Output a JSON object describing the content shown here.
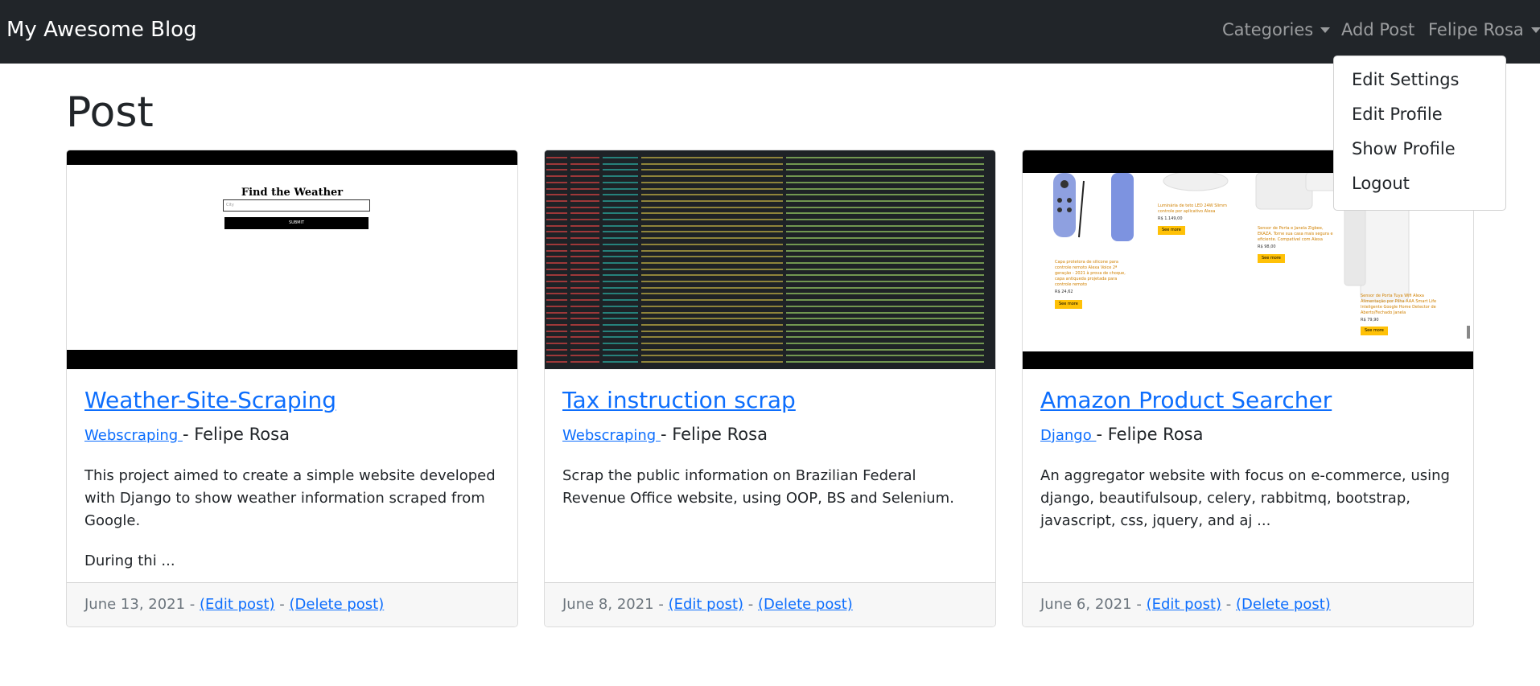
{
  "navbar": {
    "brand": "My Awesome Blog",
    "categories": "Categories",
    "add_post": "Add Post",
    "user": "Felipe Rosa",
    "background": "#212529"
  },
  "dropdown": {
    "items": [
      "Edit Settings",
      "Edit Profile",
      "Show Profile",
      "Logout"
    ]
  },
  "page": {
    "title": "Post"
  },
  "posts": [
    {
      "title": "Weather-Site-Scraping",
      "category": "Webscraping ",
      "author": "- Felipe Rosa",
      "paragraphs": [
        "This project aimed to create a simple website developed with Django to show weather information scraped from Google.",
        "During thi ..."
      ],
      "date": "June 13, 2021",
      "sep1": " - ",
      "edit": "(Edit post)",
      "sep2": " - ",
      "delete": "(Delete post)",
      "thumb": {
        "heading": "Find the Weather",
        "input_placeholder": "City",
        "button": "SUBMIT"
      }
    },
    {
      "title": "Tax instruction scrap",
      "category": "Webscraping ",
      "author": "- Felipe Rosa",
      "paragraphs": [
        "Scrap the public information on Brazilian Federal Revenue Office website, using OOP, BS and Selenium."
      ],
      "date": "June 8, 2021",
      "sep1": " - ",
      "edit": "(Edit post)",
      "sep2": " - ",
      "delete": "(Delete post)"
    },
    {
      "title": "Amazon Product Searcher",
      "category": "Django ",
      "author": "- Felipe Rosa",
      "paragraphs": [
        "An aggregator website with focus on e-commerce, using django, beautifulsoup, celery, rabbitmq, bootstrap, javascript, css, jquery, and aj ..."
      ],
      "date": "June 6, 2021",
      "sep1": " - ",
      "edit": "(Edit post)",
      "sep2": " - ",
      "delete": "(Delete post)",
      "thumb": {
        "products": [
          {
            "name": "Capa protetora de silicone para controle remoto Alexa Voice 2ª geração - 2021 à prova de choque, capa antiqueda projetada para controle remoto",
            "price": "R$ 24,62",
            "button": "See more"
          },
          {
            "name": "Luminária de teto LED 24W Slimm controle por aplicativo Alexa",
            "price": "R$ 1.149,00",
            "button": "See more"
          },
          {
            "name": "Sensor de Porta e Janela Zigbee, EKAZA. Torne sua casa mais segura e eficiente. Compatível com Alexa",
            "price": "R$ 98,00",
            "button": "See more"
          },
          {
            "name": "Sensor de Porta Tuya Wifi Alexa Alimentação por Pilha AAA Smart Life Inteligente Google Home Detector de Aberto/Fechado Janela",
            "price": "R$ 79,90",
            "button": "See more"
          }
        ]
      }
    }
  ],
  "colors": {
    "link": "#0d6efd",
    "muted": "#6c757d",
    "footer_bg": "#f7f7f7"
  }
}
